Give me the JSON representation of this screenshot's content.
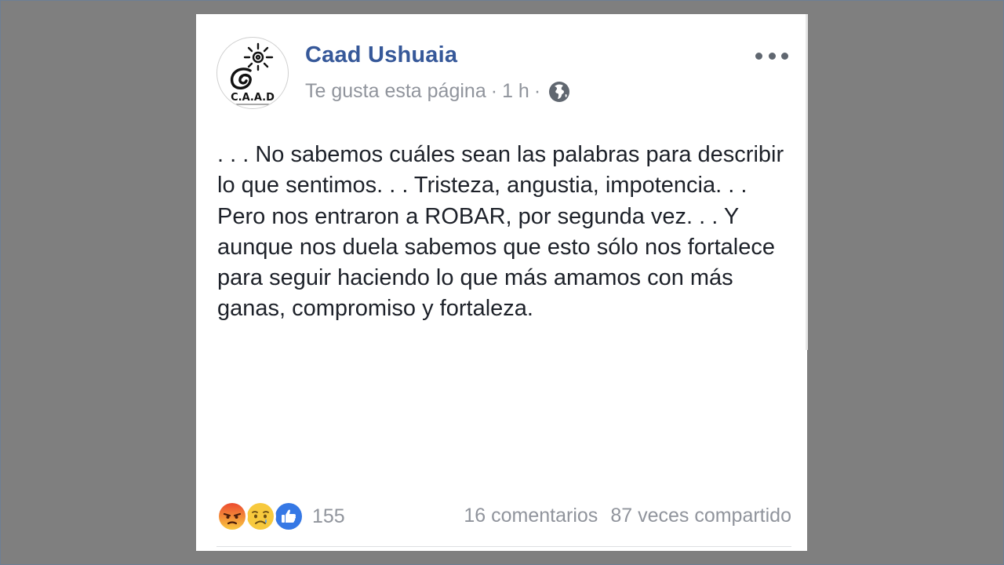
{
  "post": {
    "page_name": "Caad Ushuaia",
    "meta_follow": "Te gusta esta página",
    "meta_sep": "·",
    "time": "1 h",
    "meta_sep2": "·",
    "privacy_icon": "globe-icon",
    "text": ". . . No sabemos cuáles sean las palabras para describir lo que sentimos. . . Tristeza, angustia, impotencia. . . Pero nos entraron a ROBAR, por segunda vez. . . Y aunque nos duela sabemos que esto sólo nos fortalece para seguir haciendo lo que más amamos con más ganas, compromiso y fortaleza.",
    "avatar_text": "C.A.A.D"
  },
  "footer": {
    "reactions": [
      "angry",
      "sad",
      "like"
    ],
    "reaction_count": "155",
    "comments": "16 comentarios",
    "shares": "87 veces compartido"
  },
  "colors": {
    "background": "#7f7f7f",
    "card": "#ffffff",
    "page_name": "#365899",
    "meta": "#90949c",
    "body_text": "#1d2129",
    "like": "#3578e5",
    "angry": "#f5663b",
    "sad": "#f7c93d"
  }
}
